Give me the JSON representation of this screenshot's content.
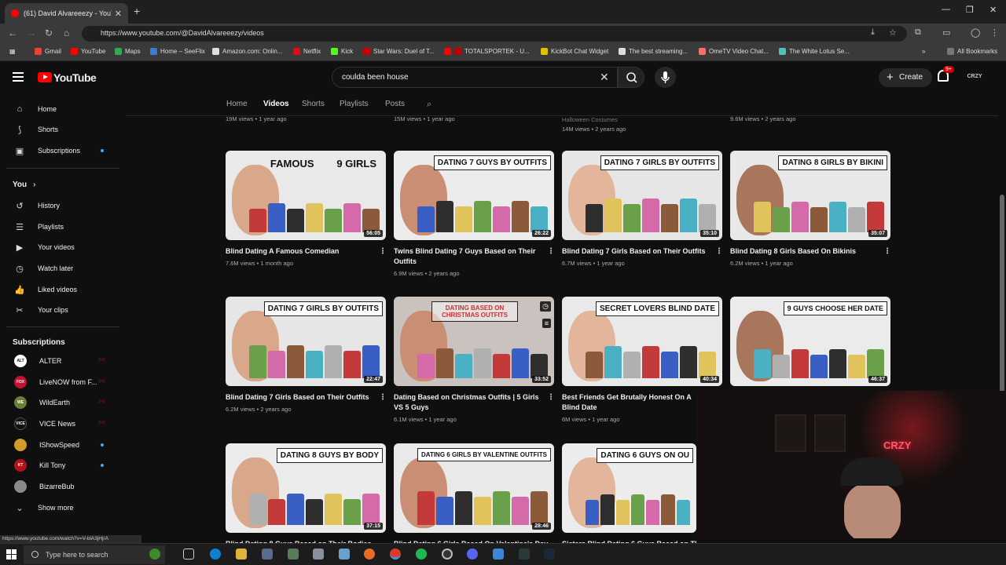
{
  "browser": {
    "tab_title": "(61) David Alvareeezy - YouTub",
    "url": "https://www.youtube.com/@DavidAlvareeezy/videos",
    "bookmarks": [
      "Gmail",
      "YouTube",
      "Maps",
      "Home – SeeFlix",
      "Amazon.com: Onlin...",
      "Netflix",
      "Kick",
      "Star Wars: Duel of T...",
      "TOTALSPORTEK - U...",
      "KickBot Chat Widget",
      "The best streaming...",
      "OmeTV Video Chat...",
      "The White Lotus Se..."
    ],
    "all_bookmarks": "All Bookmarks"
  },
  "header": {
    "logo_text": "YouTube",
    "search_value": "coulda been house",
    "create_label": "Create",
    "notif_count": "9+",
    "avatar_text": "CRZY"
  },
  "sidebar": {
    "items": [
      {
        "label": "Home"
      },
      {
        "label": "Shorts"
      },
      {
        "label": "Subscriptions"
      }
    ],
    "you_label": "You",
    "you_items": [
      {
        "label": "History"
      },
      {
        "label": "Playlists"
      },
      {
        "label": "Your videos"
      },
      {
        "label": "Watch later"
      },
      {
        "label": "Liked videos"
      },
      {
        "label": "Your clips"
      }
    ],
    "subs_heading": "Subscriptions",
    "subs": [
      {
        "label": "ALTER",
        "color": "#ffffff"
      },
      {
        "label": "LiveNOW from F...",
        "color": "#c8102e"
      },
      {
        "label": "WildEarth",
        "color": "#6b7d3a"
      },
      {
        "label": "VICE News",
        "color": "#111111"
      },
      {
        "label": "IShowSpeed",
        "color": "#d39a2c"
      },
      {
        "label": "Kill Tony",
        "color": "#b3121b"
      },
      {
        "label": "BizarreBub",
        "color": "#8a8a8a"
      }
    ],
    "show_more": "Show more"
  },
  "channel_tabs": [
    "Home",
    "Videos",
    "Shorts",
    "Playlists",
    "Posts"
  ],
  "above_meta": [
    {
      "views": "19M views",
      "age": "1 year ago"
    },
    {
      "views": "15M views",
      "age": "1 year ago"
    },
    {
      "title": "Halloween Costumes",
      "views": "14M views",
      "age": "2 years ago"
    },
    {
      "views": "9.6M views",
      "age": "2 years ago"
    }
  ],
  "videos": [
    {
      "banner": "FAMOUS        9 GIRLS",
      "duration": "56:05",
      "title": "Blind Dating A Famous Comedian",
      "views": "7.6M views",
      "age": "1 month ago",
      "bg": "#e9e9e9"
    },
    {
      "banner": "DATING 7 GUYS BY OUTFITS",
      "duration": "26:22",
      "title": "Twins Blind Dating 7 Guys Based on Their Outfits",
      "views": "6.9M views",
      "age": "2 years ago",
      "bg": "#ececec"
    },
    {
      "banner": "DATING 7 GIRLS BY OUTFITS",
      "duration": "35:10",
      "title": "Blind Dating 7 Girls Based on Their Outfits",
      "views": "6.7M views",
      "age": "1 year ago",
      "bg": "#e6e6e6"
    },
    {
      "banner": "DATING 8 GIRLS BY BIKINI",
      "duration": "35:07",
      "title": "Blind Dating 8 Girls Based On Bikinis",
      "views": "6.2M views",
      "age": "1 year ago",
      "bg": "#e8e8e8"
    },
    {
      "banner": "DATING 7 GIRLS BY OUTFITS",
      "duration": "22:47",
      "title": "Blind Dating 7 Girls Based on Their Outfits",
      "views": "6.2M views",
      "age": "2 years ago",
      "bg": "#e6e6e6"
    },
    {
      "banner": "DATING BASED ON CHRISTMAS OUTFITS",
      "duration": "33:52",
      "title": "Dating Based on Christmas Outfits | 5 Girls VS 5 Guys",
      "views": "6.1M views",
      "age": "1 year ago",
      "bg": "#c9c2bf"
    },
    {
      "banner": "SECRET LOVERS BLIND DATE",
      "duration": "40:34",
      "title": "Best Friends Get Brutally Honest On A Blind Date",
      "views": "6M views",
      "age": "1 year ago",
      "bg": "#e9e9e9"
    },
    {
      "banner": "9 GUYS CHOOSE HER DATE",
      "duration": "46:37",
      "title": "",
      "views": "",
      "age": "",
      "bg": "#ebebeb"
    },
    {
      "banner": "DATING 8 GUYS BY BODY",
      "duration": "37:15",
      "title": "Blind Dating 8 Guys Based on Their Bodies",
      "views": "",
      "age": "",
      "bg": "#ececec"
    },
    {
      "banner": "DATING 6 GIRLS BY VALENTINE OUTFITS",
      "duration": "28:46",
      "title": "Blind Dating 6 Girls Based On Valentine's Day",
      "views": "",
      "age": "",
      "bg": "#e9e9e9"
    },
    {
      "banner": "DATING 6 GUYS ON OU",
      "duration": "",
      "title": "Sisters Blind Dating 6 Guys Based on The",
      "views": "",
      "age": "",
      "bg": "#ececec"
    }
  ],
  "webcam_sign": "CRZY",
  "status_url": "https://www.youtube.com/watch?v=V-blA3jHjrA",
  "taskbar": {
    "search_placeholder": "Type here to search"
  }
}
